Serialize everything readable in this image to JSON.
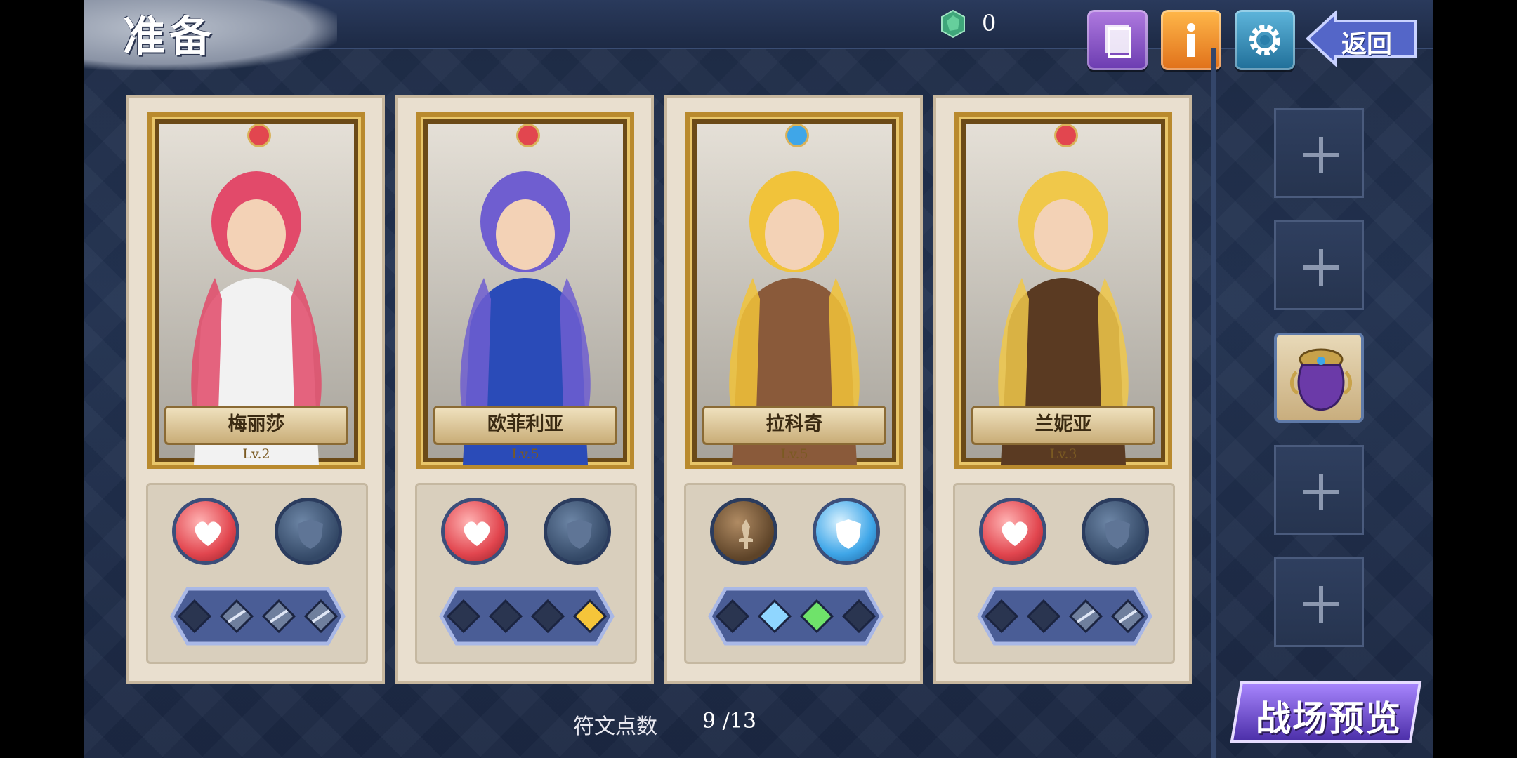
{
  "header": {
    "title": "准备",
    "gem_count": "0",
    "back_label": "返回"
  },
  "characters": [
    {
      "name": "梅丽莎",
      "level": "Lv.2",
      "element": "heart",
      "hair": "#e24a6a",
      "outfit": "#f2f2f2",
      "slot_left": "heart",
      "slot_right": "shield-empty",
      "runes": [
        "empty",
        "locked",
        "locked",
        "locked"
      ]
    },
    {
      "name": "欧菲利亚",
      "level": "Lv.5",
      "element": "heart",
      "hair": "#6f5ed0",
      "outfit": "#2a4bb8",
      "slot_left": "heart",
      "slot_right": "shield-empty",
      "runes": [
        "empty",
        "empty",
        "empty",
        "yellow"
      ]
    },
    {
      "name": "拉科奇",
      "level": "Lv.5",
      "element": "shield",
      "hair": "#f1c33a",
      "outfit": "#8a5a3a",
      "slot_left": "sword-brown",
      "slot_right": "shield-blue",
      "runes": [
        "empty",
        "blue",
        "green",
        "empty"
      ]
    },
    {
      "name": "兰妮亚",
      "level": "Lv.3",
      "element": "heart",
      "hair": "#f0c84a",
      "outfit": "#5a3a22",
      "slot_left": "heart",
      "slot_right": "shield-empty",
      "runes": [
        "empty",
        "empty",
        "locked",
        "locked"
      ]
    }
  ],
  "side_slots": [
    "add",
    "add",
    "equipment",
    "add",
    "add"
  ],
  "footer": {
    "rune_points_label": "符文点数",
    "rune_points_value": "9 /13",
    "battle_preview_label": "战场预览"
  },
  "colors": {
    "background": "#1f2c47",
    "card": "#e9dfcf",
    "gold_frame": "#b98a2e",
    "heart": "#e2464f",
    "shield_blue": "#3fa6e8"
  }
}
